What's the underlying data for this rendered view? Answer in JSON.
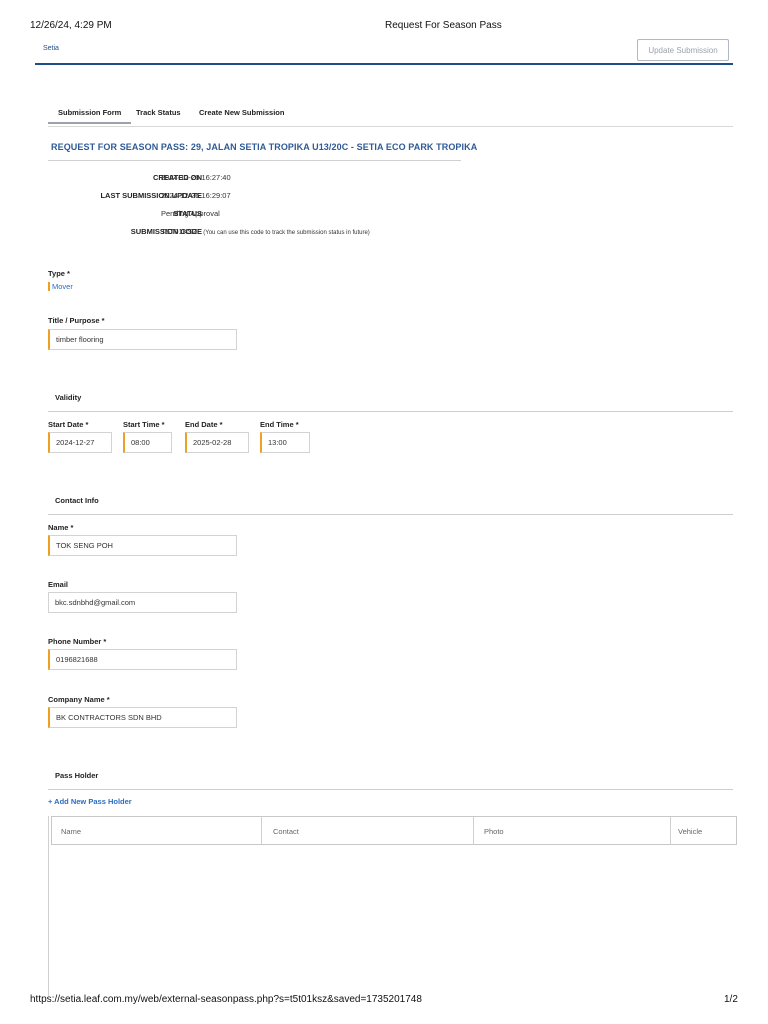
{
  "print": {
    "datetime": "12/26/24, 4:29 PM",
    "doc_title": "Request For Season Pass",
    "url": "https://setia.leaf.com.my/web/external-seasonpass.php?s=t5t01ksz&saved=1735201748",
    "page": "1/2"
  },
  "header": {
    "brand": "Setia",
    "update_button": "Update Submission"
  },
  "tabs": [
    "Submission Form",
    "Track Status",
    "Create New Submission"
  ],
  "request_title": "REQUEST FOR SEASON PASS:  29, JALAN SETIA TROPIKA U13/20C - SETIA ECO PARK TROPIKA",
  "info": {
    "created_label": "CREATED ON",
    "created_value": "2024-12-26 16:27:40",
    "updated_label": "LAST SUBMISSION UPDATE",
    "updated_value": "2024-12-26 16:29:07",
    "status_label": "STATUS",
    "status_value": "Pending Approval",
    "code_label": "SUBMISSION CODE",
    "code_value": "T5T01KSZ",
    "code_note": "(You can use this code to track the submission status in future)"
  },
  "form": {
    "type_label": "Type *",
    "type_value": "Mover",
    "title_label": "Title / Purpose *",
    "title_value": "timber flooring"
  },
  "validity": {
    "section": "Validity",
    "start_date_label": "Start Date *",
    "start_date": "2024-12-27",
    "start_time_label": "Start Time *",
    "start_time": "08:00",
    "end_date_label": "End Date *",
    "end_date": "2025-02-28",
    "end_time_label": "End Time *",
    "end_time": "13:00"
  },
  "contact": {
    "section": "Contact Info",
    "name_label": "Name *",
    "name": "TOK SENG POH",
    "email_label": "Email",
    "email": "bkc.sdnbhd@gmail.com",
    "phone_label": "Phone Number *",
    "phone": "0196821688",
    "company_label": "Company Name *",
    "company": "BK CONTRACTORS SDN BHD"
  },
  "pass_holder": {
    "section": "Pass Holder",
    "add_link": "+ Add New Pass Holder",
    "columns": [
      "Name",
      "Contact",
      "Photo",
      "Vehicle"
    ]
  },
  "colors": {
    "brand_blue": "#1f4e8c",
    "title_blue": "#2f5a96",
    "link_blue": "#2a6dc0",
    "required_orange": "#f0a020"
  }
}
